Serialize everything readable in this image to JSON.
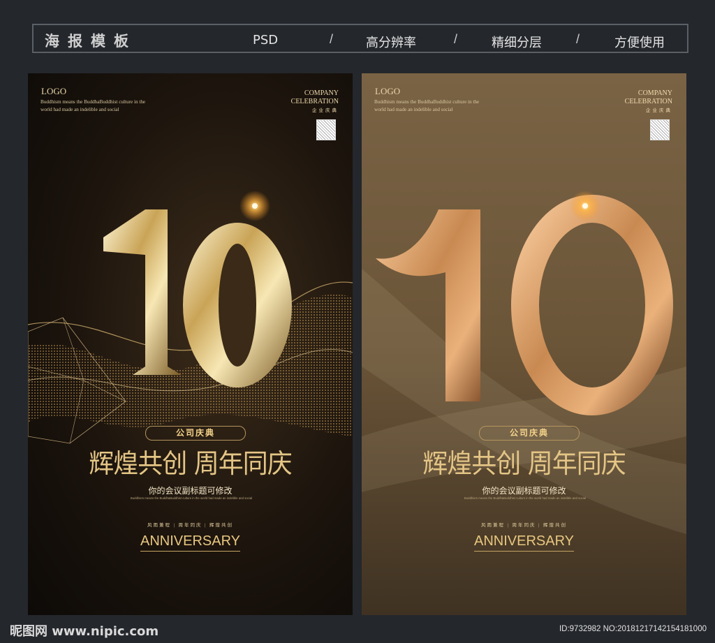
{
  "header": {
    "title": "海报模板",
    "items": [
      "PSD",
      "高分辨率",
      "精细分层",
      "方便使用"
    ],
    "separator": "/"
  },
  "poster": {
    "logo": "LOGO",
    "tagline": "Buddhism means the BuddhaBuddhist culture in the world had made an indelible and social",
    "company_line1": "COMPANY",
    "company_line2": "CELEBRATION",
    "company_cn": "企业庆典",
    "number": "10",
    "badge": "公司庆典",
    "main_title": "辉煌共创 周年同庆",
    "subtitle": "你的会议副标题可修改",
    "slogan": "风雨兼程 | 周年同庆 | 辉煌共创",
    "anniversary": "ANNIVERSARY"
  },
  "footer": {
    "site": "昵图网 www.nipic.com",
    "id": "ID:9732982 NO:20181217142154181000"
  }
}
